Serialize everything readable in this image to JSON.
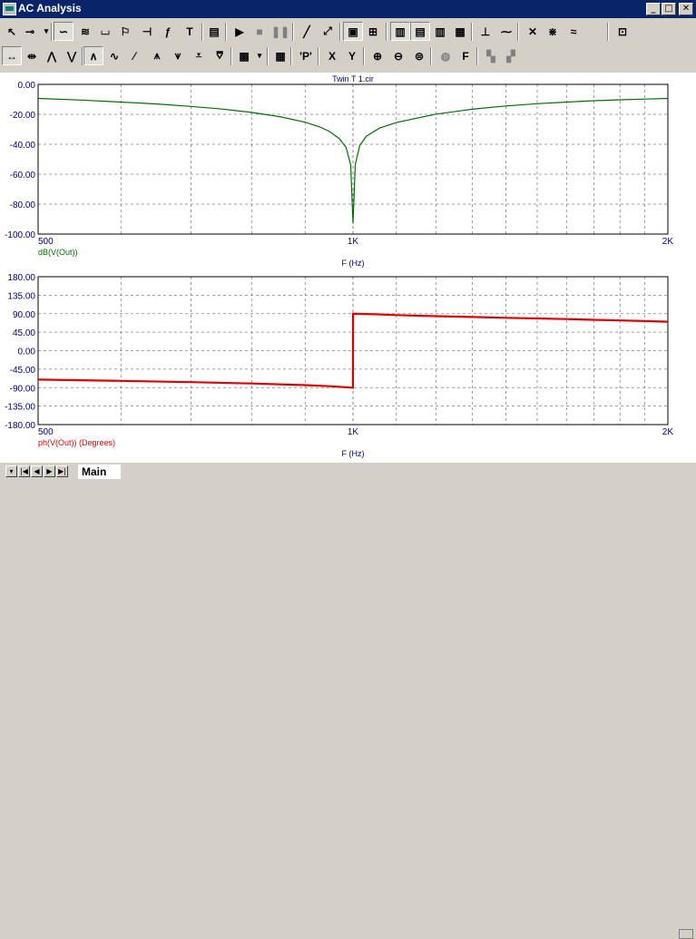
{
  "window": {
    "title": "AC Analysis"
  },
  "toolbar1": [
    {
      "name": "select-arrow-icon",
      "glyph": "↖"
    },
    {
      "name": "component-icon",
      "glyph": "⊸"
    },
    {
      "name": "dropdown-arrow-icon",
      "glyph": "▾"
    },
    {
      "name": "wire-icon",
      "glyph": "∽",
      "pressed": true
    },
    {
      "name": "bus-icon",
      "glyph": "≋"
    },
    {
      "name": "graphics-icon",
      "glyph": "⌴"
    },
    {
      "name": "flag-icon",
      "glyph": "⚐"
    },
    {
      "name": "pin-icon",
      "glyph": "⊣"
    },
    {
      "name": "fo-icon",
      "glyph": "ƒ"
    },
    {
      "name": "text-tool-icon",
      "glyph": "T"
    },
    {
      "name": "properties-icon",
      "glyph": "▤"
    },
    {
      "name": "run-icon",
      "glyph": "▶"
    },
    {
      "name": "stop-icon",
      "glyph": "■",
      "disabled": true
    },
    {
      "name": "pause-icon",
      "glyph": "❚❚",
      "disabled": true
    },
    {
      "name": "line-tool-icon",
      "glyph": "╱"
    },
    {
      "name": "diagonal-line-icon",
      "glyph": "⤢"
    },
    {
      "name": "frame-icon",
      "glyph": "▣",
      "pressed": true
    },
    {
      "name": "grid-icon",
      "glyph": "⊞"
    },
    {
      "name": "grid-layout-1-icon",
      "glyph": "▥",
      "pressed": true
    },
    {
      "name": "grid-layout-2-icon",
      "glyph": "▤",
      "pressed": true
    },
    {
      "name": "grid-layout-3-icon",
      "glyph": "▥"
    },
    {
      "name": "grid-layout-4-icon",
      "glyph": "▦"
    },
    {
      "name": "axis-icon",
      "glyph": "⊥"
    },
    {
      "name": "curve-icon",
      "glyph": "⁓"
    },
    {
      "name": "trace-icon",
      "glyph": "✕"
    },
    {
      "name": "trace-2-icon",
      "glyph": "⋇"
    },
    {
      "name": "trace-3-icon",
      "glyph": "≈"
    },
    {
      "name": "scope-icon",
      "glyph": "⊡"
    }
  ],
  "toolbar2": [
    {
      "name": "cursor-mode-icon",
      "glyph": "↔",
      "pressed": true
    },
    {
      "name": "cursor-mode-2-icon",
      "glyph": "⇹"
    },
    {
      "name": "peak-icon",
      "glyph": "⋀"
    },
    {
      "name": "valley-icon",
      "glyph": "⋁"
    },
    {
      "name": "high-icon",
      "glyph": "∧",
      "pressed": true
    },
    {
      "name": "low-icon",
      "glyph": "∿"
    },
    {
      "name": "slope-icon",
      "glyph": "⁄"
    },
    {
      "name": "next-peak-icon",
      "glyph": "⩚"
    },
    {
      "name": "next-valley-icon",
      "glyph": "⩛"
    },
    {
      "name": "bottom-icon",
      "glyph": "⩡"
    },
    {
      "name": "top-icon",
      "glyph": "⩢"
    },
    {
      "name": "tag-icon",
      "glyph": "▩"
    },
    {
      "name": "tag-dropdown-icon",
      "glyph": "▾"
    },
    {
      "name": "table-icon",
      "glyph": "▦"
    },
    {
      "name": "p-key-icon",
      "glyph": "'P'"
    },
    {
      "name": "x-scale-icon",
      "glyph": "X"
    },
    {
      "name": "y-scale-icon",
      "glyph": "Y"
    },
    {
      "name": "zoom-in-icon",
      "glyph": "⊕"
    },
    {
      "name": "zoom-out-icon",
      "glyph": "⊖"
    },
    {
      "name": "zoom-fit-icon",
      "glyph": "⊜"
    },
    {
      "name": "color-icon",
      "glyph": "◍",
      "disabled": true
    },
    {
      "name": "font-icon",
      "glyph": "F"
    },
    {
      "name": "copy-icon",
      "glyph": "▚",
      "disabled": true
    },
    {
      "name": "paste-icon",
      "glyph": "▞",
      "disabled": true
    }
  ],
  "colors": {
    "magnitude": "#007000",
    "phase": "#e00000",
    "axis_label": "#000080",
    "grid": "#808080"
  },
  "chart_data": [
    {
      "type": "line",
      "title": "Twin T 1.cir",
      "xlabel": "F (Hz)",
      "ylabel": "dB(V(Out))",
      "x_scale": "log",
      "xlim": [
        500,
        2000
      ],
      "ylim": [
        -100,
        0
      ],
      "x_tick_labels": [
        "500",
        "1K",
        "2K"
      ],
      "y_tick_labels": [
        "0.00",
        "-20.00",
        "-40.00",
        "-60.00",
        "-80.00",
        "-100.00"
      ],
      "grid": true,
      "series": [
        {
          "name": "dB(V(Out))",
          "x": [
            500,
            550,
            600,
            650,
            700,
            750,
            800,
            850,
            900,
            930,
            950,
            970,
            985,
            995,
            1000,
            1005,
            1015,
            1030,
            1060,
            1100,
            1200,
            1300,
            1400,
            1500,
            1600,
            1700,
            1800,
            1900,
            2000
          ],
          "y": [
            -9.4,
            -10.5,
            -11.8,
            -13.1,
            -14.7,
            -16.5,
            -18.7,
            -21.5,
            -25.3,
            -28.5,
            -31.6,
            -36.1,
            -42.1,
            -54.0,
            -93.0,
            -53.6,
            -40.8,
            -34.6,
            -29.2,
            -25.5,
            -19.9,
            -16.6,
            -14.4,
            -12.9,
            -11.8,
            -10.9,
            -10.3,
            -9.8,
            -9.4
          ]
        }
      ]
    },
    {
      "type": "line",
      "xlabel": "F (Hz)",
      "ylabel": "ph(V(Out)) (Degrees)",
      "x_scale": "log",
      "xlim": [
        500,
        2000
      ],
      "ylim": [
        -180,
        180
      ],
      "x_tick_labels": [
        "500",
        "1K",
        "2K"
      ],
      "y_tick_labels": [
        "180.00",
        "135.00",
        "90.00",
        "45.00",
        "0.00",
        "-45.00",
        "-90.00",
        "-135.00",
        "-180.00"
      ],
      "grid": true,
      "series": [
        {
          "name": "ph(V(Out)) (Degrees)",
          "x": [
            500,
            600,
            700,
            800,
            900,
            950,
            999.9,
            1000.1,
            1050,
            1100,
            1200,
            1300,
            1400,
            1500,
            1600,
            1700,
            1800,
            1900,
            2000
          ],
          "y": [
            -70.5,
            -73.6,
            -76.7,
            -80.0,
            -84.0,
            -86.5,
            -90.0,
            90.0,
            88.5,
            86.5,
            84.0,
            82.0,
            80.0,
            78.5,
            76.8,
            75.2,
            73.6,
            72.0,
            70.5
          ]
        }
      ]
    }
  ],
  "tabs": {
    "main_label": "Main"
  },
  "nav_buttons": [
    {
      "name": "tab-nav-menu-button",
      "glyph": "▾"
    },
    {
      "name": "tab-nav-first-button",
      "glyph": "|◀"
    },
    {
      "name": "tab-nav-prev-button",
      "glyph": "◀"
    },
    {
      "name": "tab-nav-next-button",
      "glyph": "▶"
    },
    {
      "name": "tab-nav-last-button",
      "glyph": "▶|"
    }
  ],
  "window_buttons": [
    {
      "name": "minimize-button",
      "glyph": "_"
    },
    {
      "name": "maximize-button",
      "glyph": "□"
    },
    {
      "name": "close-button",
      "glyph": "✕"
    }
  ]
}
